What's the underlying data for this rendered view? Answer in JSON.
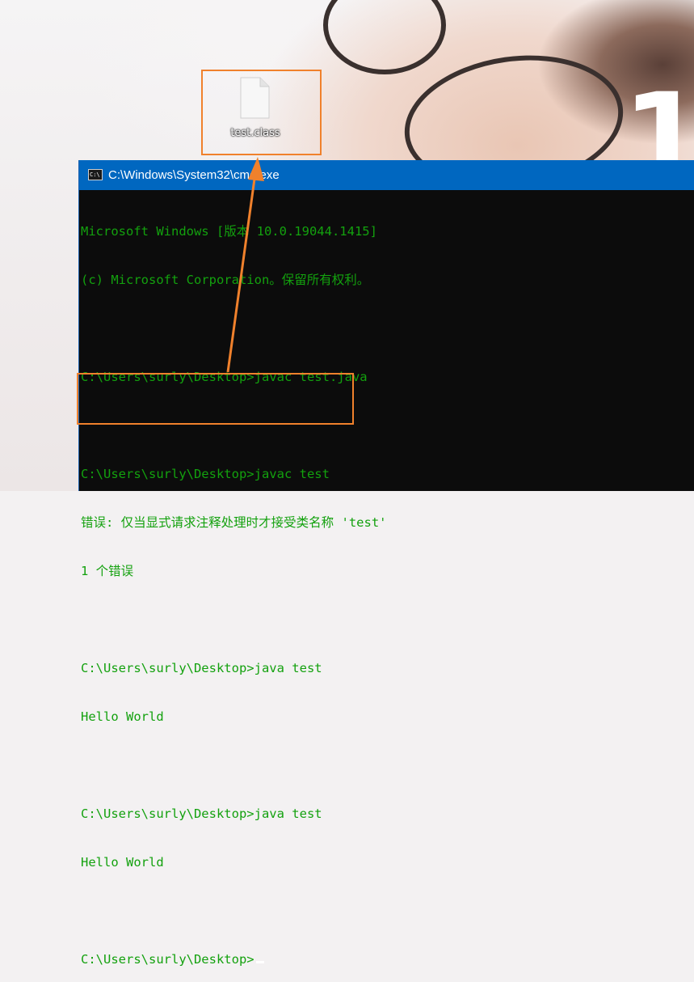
{
  "desktop": {
    "file_icon": {
      "label": "test.class",
      "icon": "document-file-icon"
    },
    "wallpaper_numeral": "1"
  },
  "cmd_window": {
    "title": "C:\\Windows\\System32\\cmd.exe",
    "icon": "cmd-icon",
    "icon_text": "C:\\",
    "lines": [
      "Microsoft Windows [版本 10.0.19044.1415]",
      "(c) Microsoft Corporation。保留所有权利。",
      "",
      "C:\\Users\\surly\\Desktop>javac test.java",
      "",
      "C:\\Users\\surly\\Desktop>javac test",
      "错误: 仅当显式请求注释处理时才接受类名称 'test'",
      "1 个错误",
      "",
      "C:\\Users\\surly\\Desktop>java test",
      "Hello World",
      "",
      "C:\\Users\\surly\\Desktop>java test",
      "Hello World",
      "",
      "C:\\Users\\surly\\Desktop>"
    ]
  },
  "colors": {
    "console_text": "#13a10e",
    "titlebar": "#0067c0",
    "highlight_box": "#f0812c"
  }
}
